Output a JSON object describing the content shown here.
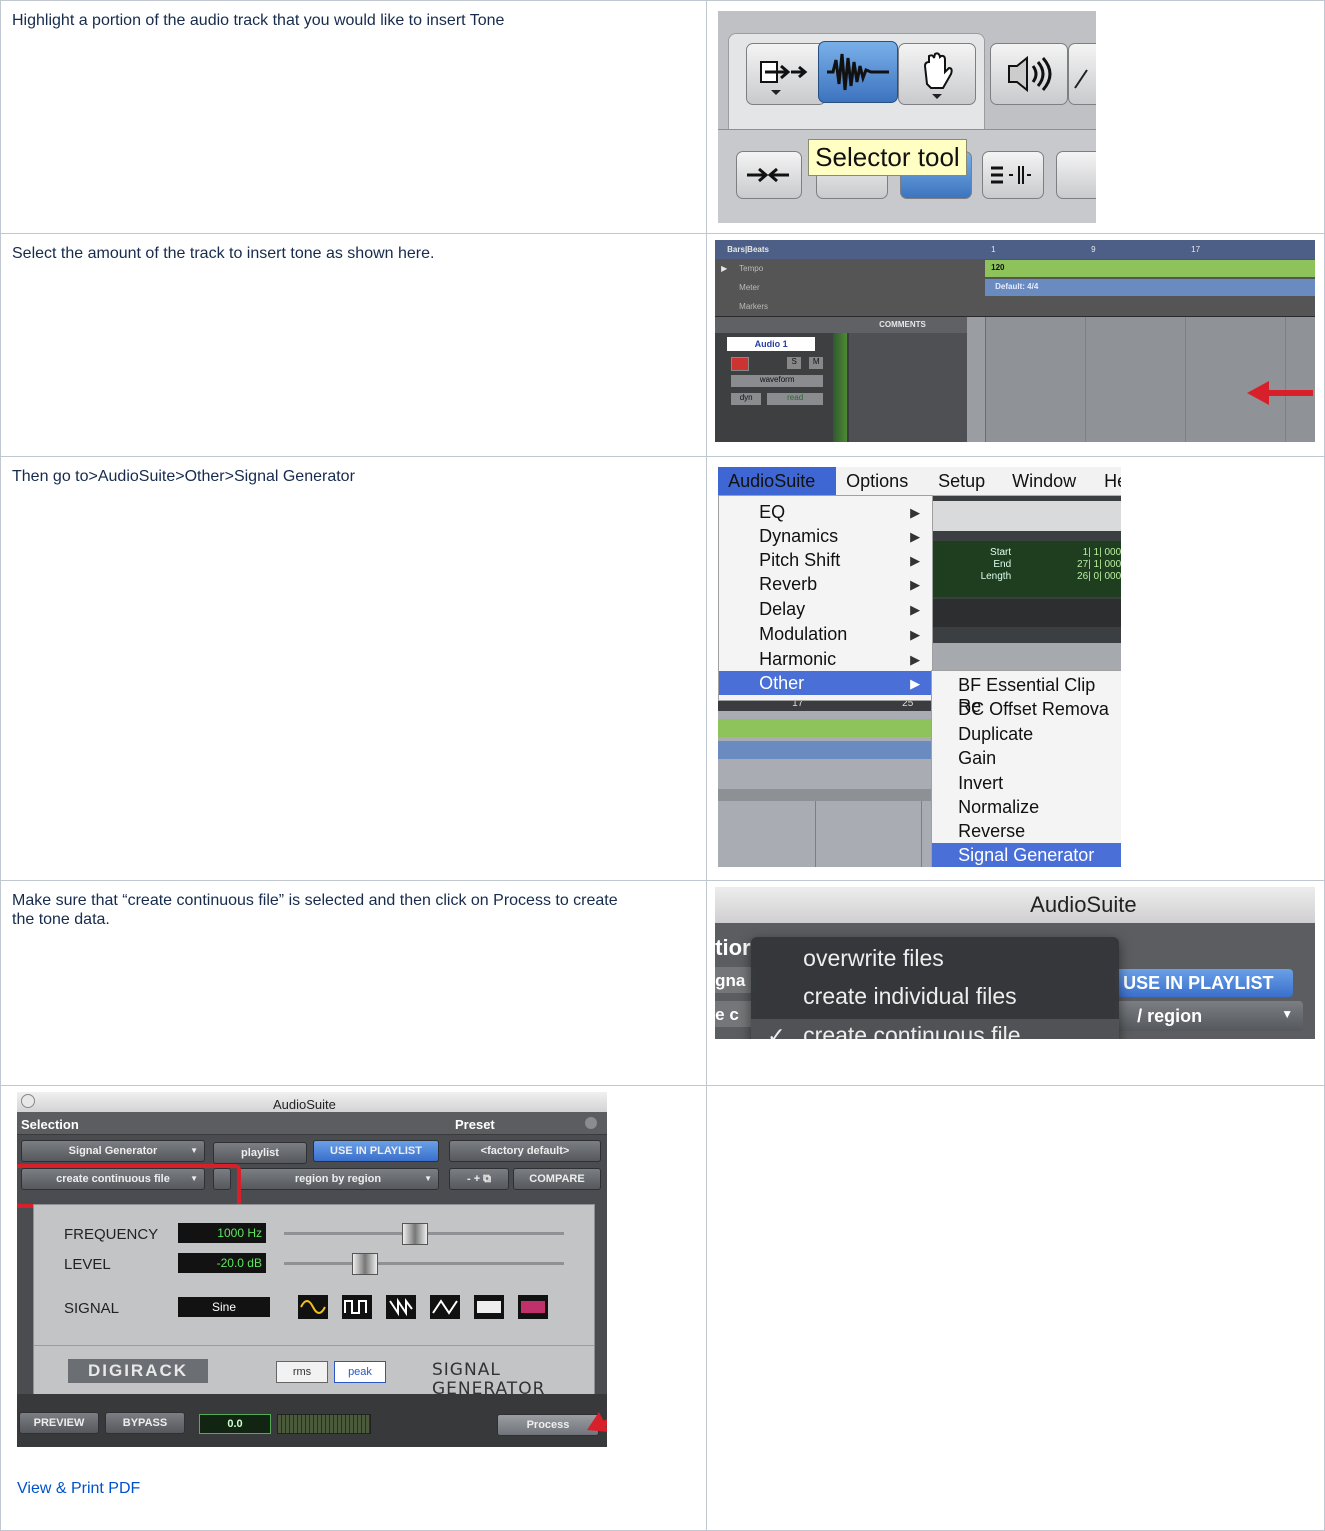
{
  "steps": [
    {
      "text": "Highlight a portion of the audio track that you would like to insert Tone"
    },
    {
      "text": "Select the amount of the track to insert tone as shown here."
    },
    {
      "text": "Then go to>AudioSuite>Other>Signal Generator"
    },
    {
      "text_lines": [
        "Make sure that “create continuous file” is selected and then click on Process to create",
        "the tone data."
      ]
    }
  ],
  "shot1": {
    "tooltip": "Selector tool"
  },
  "shot2": {
    "ruler_rows": [
      "Bars|Beats",
      "Tempo",
      "Meter",
      "Markers"
    ],
    "bar_numbers": [
      "1",
      "9",
      "17"
    ],
    "tempo_value": "120",
    "meter_value": "Default: 4/4",
    "comments_header": "COMMENTS",
    "track_name": "Audio 1",
    "track_buttons": {
      "s": "S",
      "m": "M"
    },
    "view_select": "waveform",
    "auto_left": "dyn",
    "auto_right": "read"
  },
  "shot3": {
    "menubar": [
      "AudioSuite",
      "Options",
      "Setup",
      "Window",
      "He"
    ],
    "menu_items": [
      "EQ",
      "Dynamics",
      "Pitch Shift",
      "Reverb",
      "Delay",
      "Modulation",
      "Harmonic",
      "Other"
    ],
    "submenu_items": [
      "BF Essential Clip Re",
      "DC Offset Remova",
      "Duplicate",
      "Gain",
      "Invert",
      "Normalize",
      "Reverse",
      "Signal Generator"
    ],
    "counter_labels": [
      "Start",
      "End",
      "Length"
    ],
    "counter_values": [
      "1| 1| 000",
      "27| 1| 000",
      "26| 0| 000"
    ],
    "ruler_labels": [
      "17",
      "25"
    ]
  },
  "shot4": {
    "title": "AudioSuite",
    "options": [
      "overwrite files",
      "create individual files",
      "create continuous file"
    ],
    "checkmark": "✓",
    "bg_left": [
      "tior",
      "gna",
      "e c"
    ],
    "bg_button": "USE IN PLAYLIST",
    "bg_region": "region"
  },
  "shot5": {
    "title": "AudioSuite",
    "selection_label": "Selection",
    "preset_label": "Preset",
    "plugin_select": "Signal Generator",
    "playlist_select": "playlist",
    "use_in_playlist": "USE IN PLAYLIST",
    "preset_select": "<factory default>",
    "file_mode": "create continuous file",
    "region_mode": "region by region",
    "preset_controls": "- + ",
    "compare": "COMPARE",
    "freq_label": "FREQUENCY",
    "freq_value": "1000 Hz",
    "level_label": "LEVEL",
    "level_value": "-20.0 dB",
    "signal_label": "SIGNAL",
    "signal_value": "Sine",
    "digirack": "DIGIRACK",
    "rms": "rms",
    "peak": "peak",
    "plugin_title": "SIGNAL GENERATOR",
    "preview": "PREVIEW",
    "bypass": "BYPASS",
    "meter_value": "0.0",
    "process": "Process"
  },
  "footer_link": "View & Print PDF",
  "colors": {
    "link": "#0052cc",
    "border": "#c1c7d0",
    "arrow_red": "#d8202a",
    "selection_green": "#8ec25a",
    "menu_highlight": "#4a6fd6"
  }
}
